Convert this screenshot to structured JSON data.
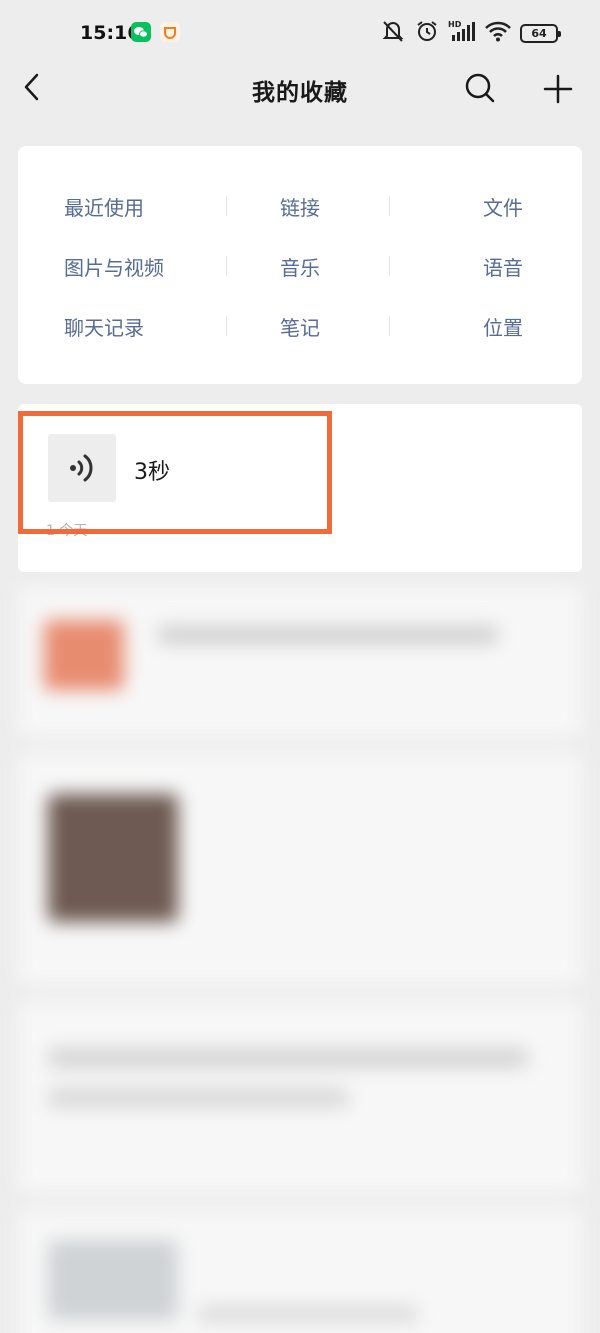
{
  "status_bar": {
    "time": "15:16",
    "battery": "64",
    "icons": [
      "wechat-icon",
      "app-notification-icon",
      "mute-icon",
      "alarm-icon",
      "hd-signal-icon",
      "wifi-icon",
      "battery-icon"
    ]
  },
  "nav": {
    "title": "我的收藏",
    "icons": [
      "back-icon",
      "search-icon",
      "add-icon"
    ]
  },
  "categories": [
    [
      "最近使用",
      "链接",
      "文件"
    ],
    [
      "图片与视频",
      "音乐",
      "语音"
    ],
    [
      "聊天记录",
      "笔记",
      "位置"
    ]
  ],
  "favorite_item": {
    "icon": "voice-icon",
    "duration": "3秒",
    "meta": "1  今天"
  },
  "colors": {
    "link_blue": "#576b95",
    "highlight": "#f26a3a",
    "background": "#ededed",
    "wechat_green": "#07c160"
  }
}
